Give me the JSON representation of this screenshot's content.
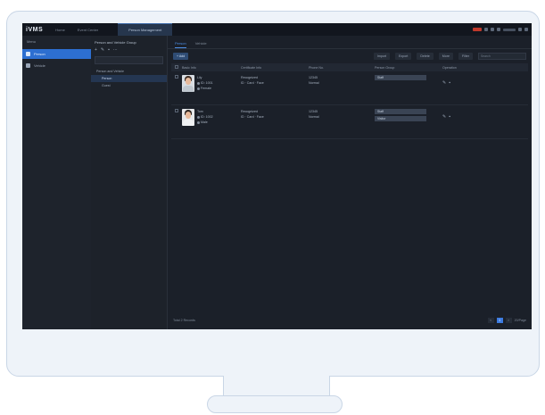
{
  "app": {
    "logo": "iVMS"
  },
  "topbar": {
    "tabs": [
      "Home",
      "Event Center",
      "Person Management"
    ],
    "active_tab": "Person Management",
    "user": "admin"
  },
  "leftnav": {
    "header": "Menu",
    "items": [
      {
        "label": "Person",
        "icon": "person-icon",
        "active": true
      },
      {
        "label": "Vehicle",
        "icon": "vehicle-icon",
        "active": false
      }
    ]
  },
  "groups": {
    "title": "Person and Vehicle Group",
    "search_placeholder": "Search",
    "tree": [
      {
        "label": "Person and Vehicle",
        "level": 0,
        "selected": false
      },
      {
        "label": "Person",
        "level": 1,
        "selected": true
      },
      {
        "label": "Guest",
        "level": 1,
        "selected": false
      }
    ]
  },
  "main": {
    "subtabs": [
      "Person",
      "Vehicle"
    ],
    "active_subtab": "Person",
    "toolbar": {
      "add": "+ Add",
      "actions": [
        "Import",
        "Export",
        "Delete",
        "More"
      ],
      "filter": "Filter",
      "search_placeholder": "Search"
    },
    "columns": [
      "Basic Info",
      "Certificate Info",
      "Phone No.",
      "Person Group",
      "Operation"
    ],
    "rows": [
      {
        "name": "Lily",
        "id": "ID: 1001",
        "gender": "Female",
        "cert_title": "Recognized",
        "cert_line": "ID  · Card  · Face",
        "phone": "12345",
        "phone_note": "Normal",
        "groups": [
          "Staff"
        ]
      },
      {
        "name": "Tom",
        "id": "ID: 1002",
        "gender": "Male",
        "cert_title": "Recognized",
        "cert_line": "ID  · Card  · Face",
        "phone": "12345",
        "phone_note": "Normal",
        "groups": [
          "Staff",
          "Visitor"
        ]
      }
    ],
    "footer": {
      "total": "Total 2 Records",
      "pages": [
        "<",
        "1",
        ">"
      ],
      "current_page": "1",
      "page_size": "20/Page"
    }
  },
  "colors": {
    "accent": "#2d6fd1",
    "background": "#1b2029"
  }
}
